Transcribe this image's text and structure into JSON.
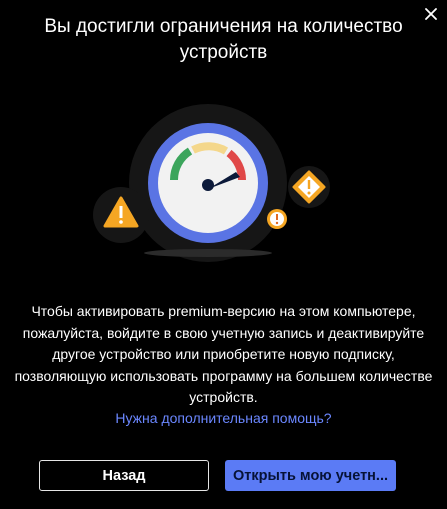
{
  "dialog": {
    "title": "Вы достигли ограничения на количество устройств",
    "description": "Чтобы активировать premium-версию на этом компьютере, пожалуйста, войдите в свою учетную запись и деактивируйте другое устройство или приобретите новую подписку, позволяющую использовать программу на большем количестве устройств.",
    "help_link": "Нужна дополнительная помощь?",
    "back_button": "Назад",
    "open_account_button": "Открыть мою учетн..."
  },
  "colors": {
    "background": "#000000",
    "accent": "#5b7bf5",
    "link": "#6b87ff"
  },
  "icons": [
    "close-icon",
    "speedometer-icon",
    "warning-triangle-icon",
    "warning-diamond-icon",
    "exclamation-circle-icon"
  ]
}
